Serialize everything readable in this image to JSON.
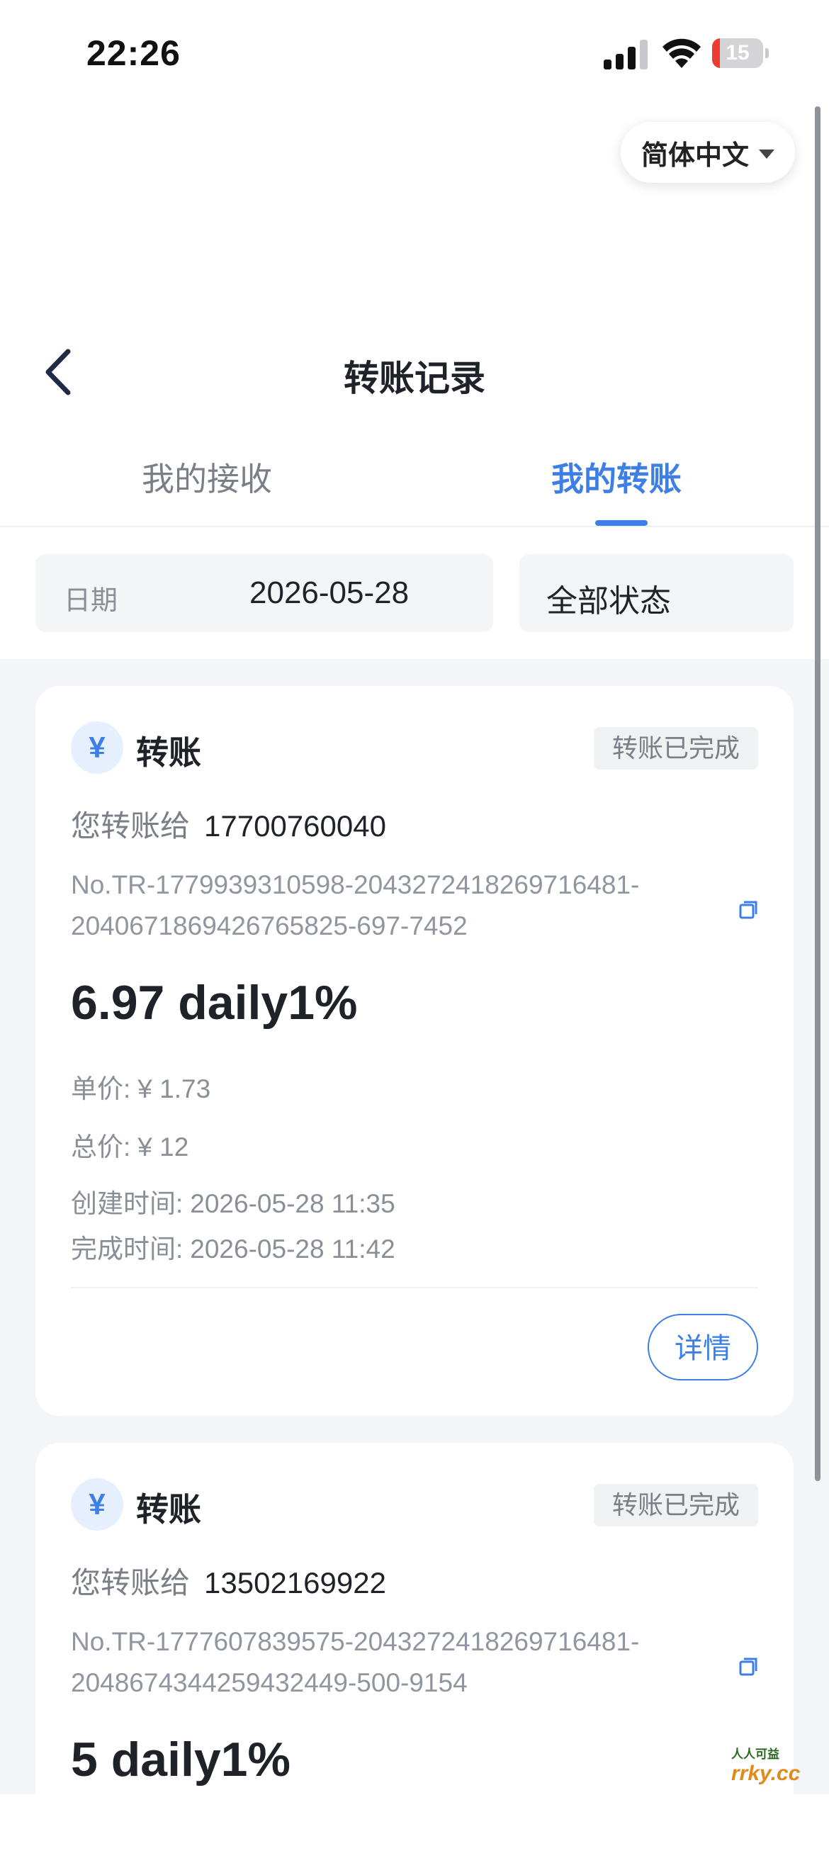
{
  "status_bar": {
    "time": "22:26",
    "battery": "15",
    "battery_level": 0.15
  },
  "language": {
    "label": "简体中文"
  },
  "header": {
    "title": "转账记录"
  },
  "tabs": [
    {
      "label": "我的接收",
      "active": false
    },
    {
      "label": "我的转账",
      "active": true
    }
  ],
  "filters": {
    "date_label": "日期",
    "date_value": "2026-05-28",
    "status_value": "全部状态"
  },
  "records": [
    {
      "icon": "¥",
      "type": "转账",
      "status": "转账已完成",
      "recipient_label": "您转账给",
      "recipient": "17700760040",
      "order_no_line1": "No.TR-1779939310598-2043272418269716481-",
      "order_no_line2": "2040671869426765825-697-7452",
      "amount": "6.97 daily1%",
      "unit_price_label": "单价:",
      "unit_price": "¥ 1.73",
      "total_label": "总价:",
      "total": "¥ 12",
      "created_label": "创建时间:",
      "created": "2026-05-28 11:35",
      "completed_label": "完成时间:",
      "completed": "2026-05-28 11:42",
      "detail_button": "详情"
    },
    {
      "icon": "¥",
      "type": "转账",
      "status": "转账已完成",
      "recipient_label": "您转账给",
      "recipient": "13502169922",
      "order_no_line1": "No.TR-1777607839575-2043272418269716481-",
      "order_no_line2": "2048674344259432449-500-9154",
      "amount": "5 daily1%"
    }
  ],
  "watermark": {
    "top": "人人可益",
    "bottom": "rrky.cc"
  },
  "colors": {
    "accent": "#3d7fe6",
    "battery_low": "#ee3a33"
  }
}
